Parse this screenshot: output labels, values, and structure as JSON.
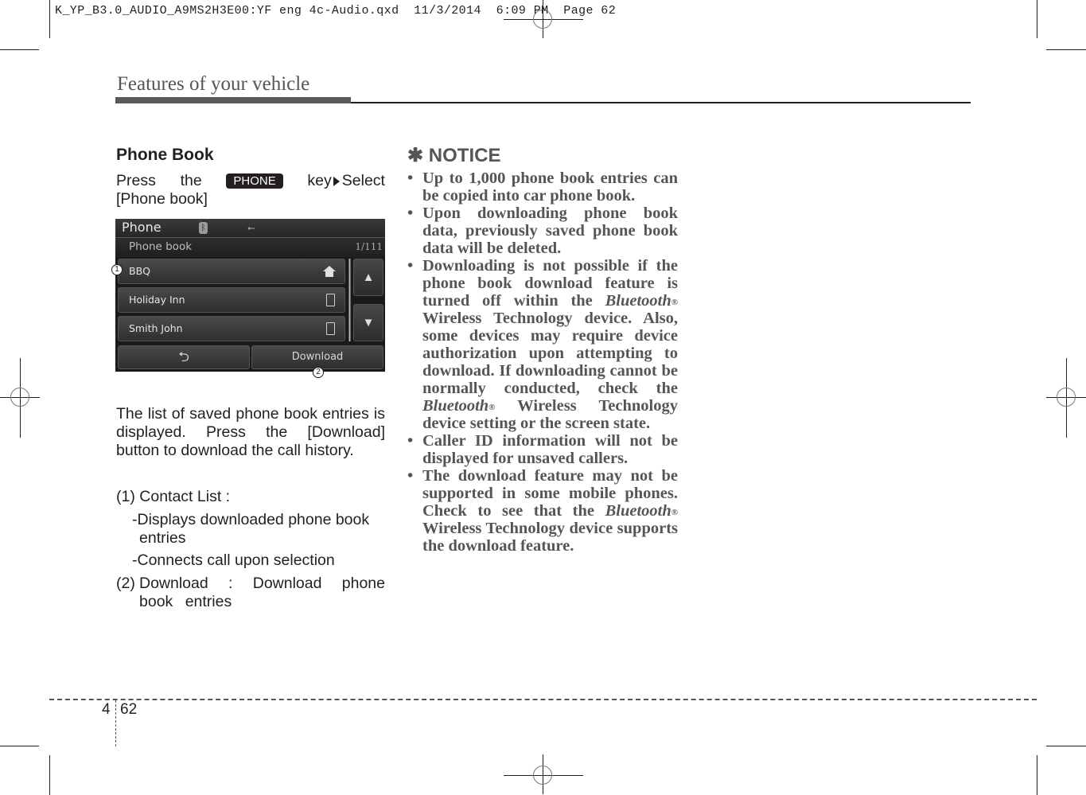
{
  "slug": {
    "text": "K_YP_B3.0_AUDIO_A9MS2H3E00:YF eng 4c-Audio.qxd  11/3/2014  6:09 PM  Page 62"
  },
  "header": {
    "section_title": "Features of your vehicle"
  },
  "left": {
    "heading": "Phone Book",
    "instruction": {
      "press": "Press",
      "the": "the",
      "key_label": "PHONE",
      "key": "key",
      "select": "Select",
      "target": "[Phone book]"
    },
    "screen": {
      "title": "Phone",
      "bluetooth_icon": "bluetooth-icon",
      "usb_icon": "usb-icon",
      "subtitle": "Phone book",
      "page_count": "1/111",
      "contacts": [
        {
          "name": "BBQ",
          "icon": "home-icon"
        },
        {
          "name": "Holiday Inn",
          "icon": "mobile-phone-icon"
        },
        {
          "name": "Smith John",
          "icon": "mobile-phone-icon"
        }
      ],
      "scroll_up_icon": "▲",
      "scroll_down_icon": "▼",
      "back_icon": "⮌",
      "download_label": "Download",
      "callouts": [
        "1",
        "2"
      ]
    },
    "description": "The list of saved phone book entries is displayed. Press the [Download] button to download the call history.",
    "items": [
      {
        "num": "(1)",
        "label": "Contact List :",
        "subitems": [
          "-Displays downloaded phone book entries",
          "-Connects call upon selection"
        ]
      },
      {
        "num": "(2)",
        "label": "Download : Download phone book entries"
      }
    ]
  },
  "notice": {
    "symbol": "✱",
    "heading": "NOTICE",
    "bullets": [
      "Up to 1,000 phone book entries can be copied into car phone book.",
      "Upon downloading phone book data, previously saved phone book data will be deleted."
    ],
    "bullet3": {
      "part1": "Downloading is not possible if the phone book download feature is turned off within the ",
      "brand": "Bluetooth",
      "reg": "®",
      "part2": " Wireless Technology device. Also, some devices may require device authorization upon attempting to download. If downloading cannot be normally conducted, check the ",
      "part3": " Wireless Technology device setting or the screen state."
    },
    "bullet4": "Caller ID information will not be displayed for unsaved callers.",
    "bullet5": {
      "part1": "The download feature may not be supported in some mobile phones. Check to see that the ",
      "brand": "Bluetooth",
      "reg": "®",
      "part2": " Wireless Technology device supports the download feature."
    },
    "bullet_char": "•"
  },
  "footer": {
    "chapter": "4",
    "page": "62"
  }
}
